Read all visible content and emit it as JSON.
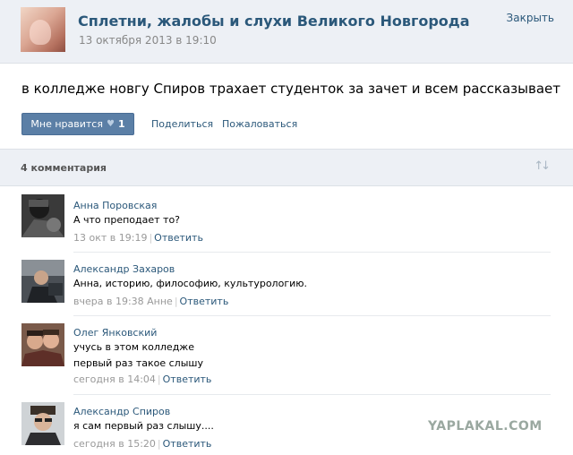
{
  "post": {
    "group_name": "Сплетни, жалобы и слухи Великого Новгорода",
    "date": "13 октября 2013 в 19:10",
    "close_label": "Закрыть",
    "text": "в колледже новгу Спиров трахает студенток за зачет и всем рассказывает",
    "like_label": "Мне нравится",
    "like_count": "1",
    "share_label": "Поделиться",
    "complain_label": "Пожаловаться"
  },
  "comments_header": {
    "count_label": "4 комментария"
  },
  "comments": [
    {
      "author": "Анна Поровская",
      "lines": [
        "А что преподает то?"
      ],
      "time": "13 окт в 19:19",
      "reply": "Ответить"
    },
    {
      "author": "Александр Захаров",
      "lines": [
        "Анна, историю, философию, культурологию."
      ],
      "time": "вчера в 19:38 Анне",
      "reply": "Ответить"
    },
    {
      "author": "Олег Янковский",
      "lines": [
        "учусь в этом колледже",
        "первый раз такое слышу"
      ],
      "time": "сегодня в 14:04",
      "reply": "Ответить"
    },
    {
      "author": "Александр Спиров",
      "lines": [
        "я сам первый раз слышу...."
      ],
      "time": "сегодня в 15:20",
      "reply": "Ответить"
    }
  ],
  "watermark": "YAPLAKAL.COM"
}
